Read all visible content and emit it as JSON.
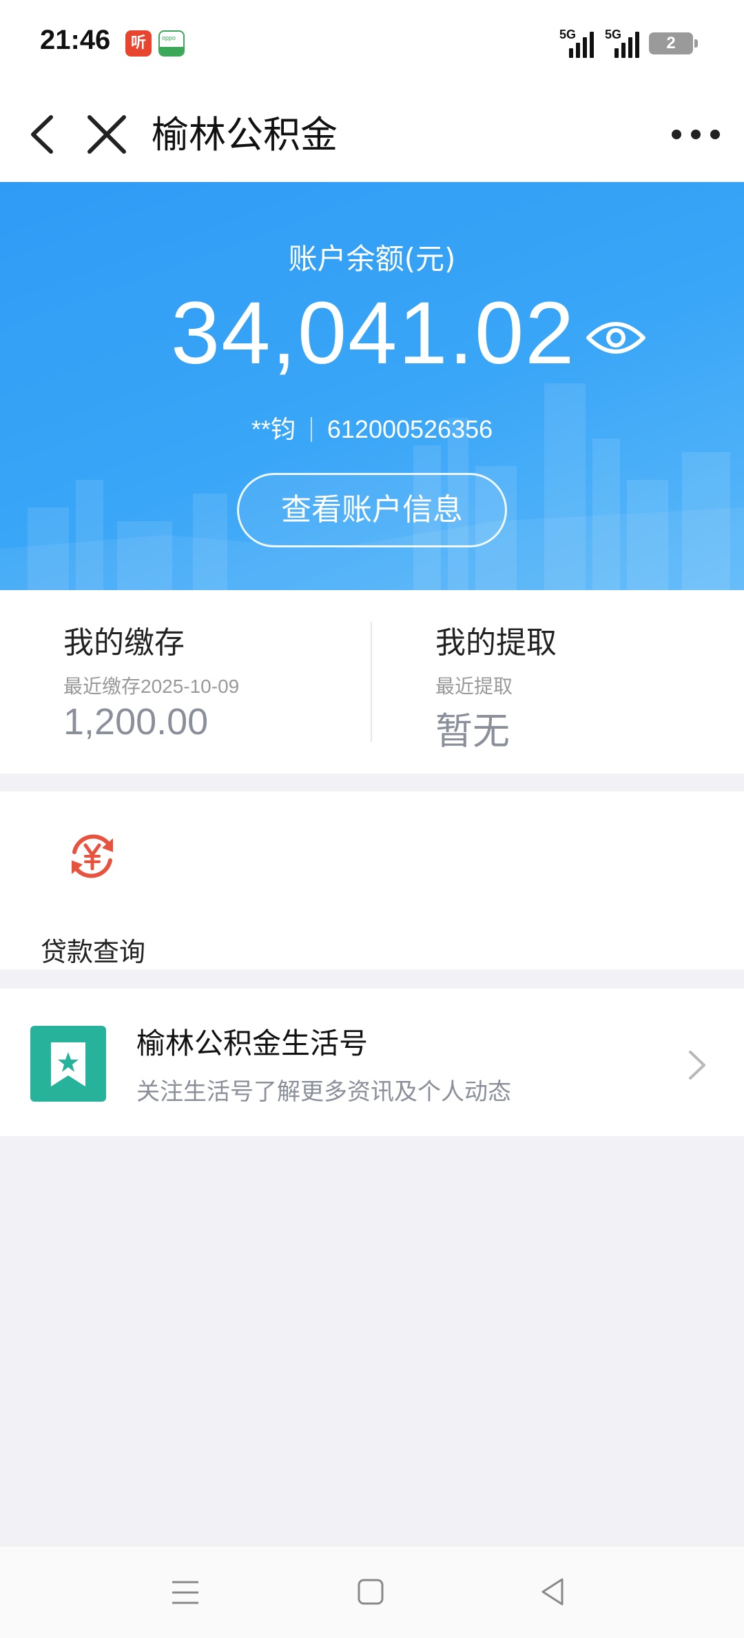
{
  "status_bar": {
    "time": "21:46",
    "app_icon_1_text": "听",
    "app_icon_2_text": "oppo",
    "signal_1_label": "5G",
    "signal_2_label": "5G",
    "battery_level": "2"
  },
  "nav": {
    "title": "榆林公积金",
    "back_icon": "chevron-left-icon",
    "close_icon": "close-icon",
    "more_icon": "more-horizontal-icon"
  },
  "account": {
    "balance_label": "账户余额(元)",
    "balance_value": "34,041.02",
    "holder_name": "**钧",
    "account_number": "612000526356",
    "view_info_button": "查看账户信息",
    "eye_icon": "eye-icon"
  },
  "summary": {
    "deposit": {
      "title": "我的缴存",
      "subtitle": "最近缴存2025-10-09",
      "value": "1,200.00"
    },
    "withdraw": {
      "title": "我的提取",
      "subtitle": "最近提取",
      "value": "暂无"
    }
  },
  "services": [
    {
      "label": "贷款查询",
      "icon": "loan-yuan-refresh-icon"
    }
  ],
  "life_account": {
    "title": "榆林公积金生活号",
    "subtitle": "关注生活号了解更多资讯及个人动态",
    "icon": "bookmark-star-icon"
  },
  "colors": {
    "hero_blue": "#2f9bf5",
    "life_icon_green": "#27b39b",
    "loan_icon_red": "#e8533f"
  }
}
